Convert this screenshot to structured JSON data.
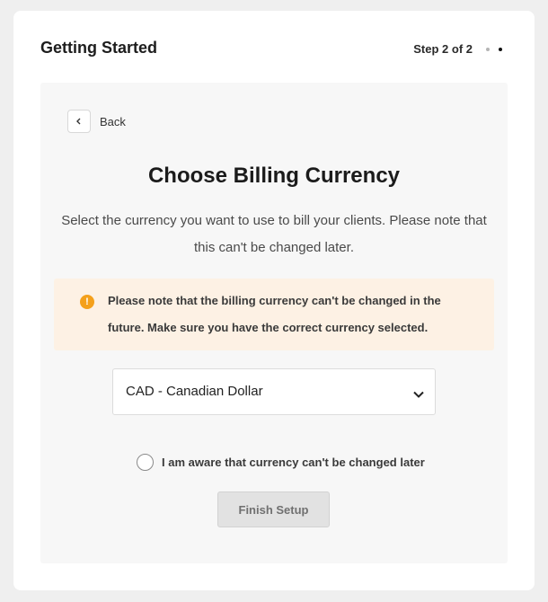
{
  "header": {
    "title": "Getting Started",
    "step_text": "Step 2 of 2",
    "step_total": 2,
    "step_current": 2
  },
  "back": {
    "label": "Back",
    "icon": "chevron-left-icon"
  },
  "content": {
    "title": "Choose Billing Currency",
    "description": "Select the currency you want to use to bill your clients. Please note that this can't be changed later."
  },
  "alert": {
    "icon": "warning-icon",
    "icon_glyph": "!",
    "text": "Please note that the billing currency can't be changed in the future. Make sure you have the correct currency selected.",
    "color": "#f4a01b",
    "background": "#fdf1e4"
  },
  "currency_select": {
    "value": "CAD - Canadian Dollar",
    "icon": "chevron-down-icon"
  },
  "confirm_checkbox": {
    "label": "I am aware that currency can't be changed later",
    "checked": false
  },
  "finish_button": {
    "label": "Finish Setup",
    "enabled": false
  }
}
